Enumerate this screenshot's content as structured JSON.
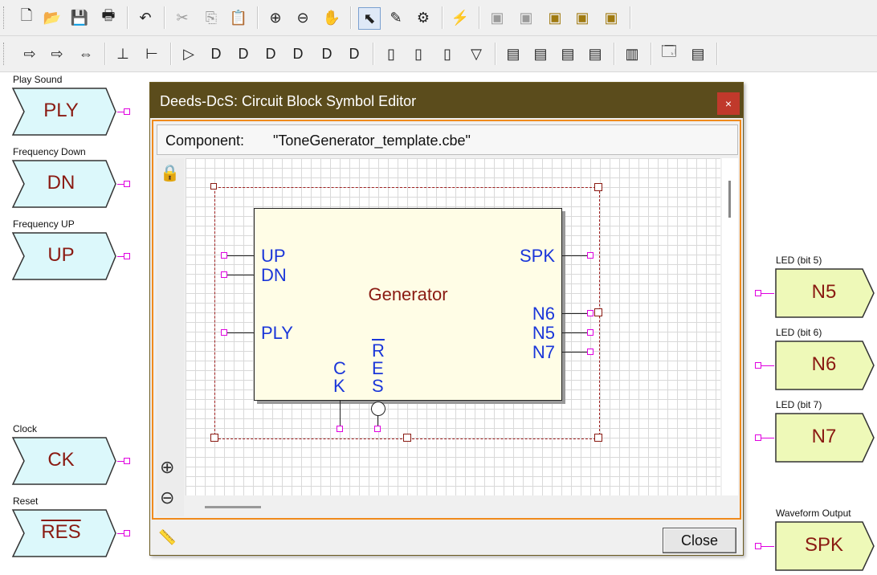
{
  "dialog": {
    "title": "Deeds-DcS: Circuit Block Symbol Editor",
    "close_x": "×",
    "component_label": "Component:",
    "component_value": "\"ToneGenerator_template.cbe\"",
    "close_button": "Close"
  },
  "block": {
    "name": "Generator",
    "left_pins": [
      "UP",
      "DN",
      "PLY"
    ],
    "right_pins": [
      "SPK",
      "N6",
      "N5",
      "N7"
    ],
    "bottom_pins": [
      "C",
      "K",
      "R",
      "E",
      "S"
    ]
  },
  "inputs": [
    {
      "label": "Play Sound",
      "text": "PLY"
    },
    {
      "label": "Frequency Down",
      "text": "DN"
    },
    {
      "label": "Frequency UP",
      "text": "UP"
    },
    {
      "label": "Clock",
      "text": "CK"
    },
    {
      "label": "Reset",
      "text": "RES"
    }
  ],
  "outputs": [
    {
      "label": "LED (bit 5)",
      "text": "N5"
    },
    {
      "label": "LED (bit 6)",
      "text": "N6"
    },
    {
      "label": "LED (bit 7)",
      "text": "N7"
    },
    {
      "label": "Waveform Output",
      "text": "SPK"
    }
  ],
  "colors": {
    "input_fill": "#dcf8fb",
    "output_fill": "#eef9b8",
    "block_fill": "#fffde6",
    "pin": "#e000e0",
    "dialog_title_bg": "#5b4c1c",
    "dialog_border": "#f08a1c",
    "close_red": "#c0392b"
  },
  "toolbar_icons": {
    "row1": [
      "new-icon",
      "open-icon",
      "save-icon",
      "print-icon",
      "undo-icon",
      "cut-icon",
      "copy-icon",
      "paste-icon",
      "zoom-in-icon",
      "zoom-out-icon",
      "hand-icon",
      "pointer-icon",
      "wire-icon",
      "component-icon",
      "simulation-icon",
      "chip-icon",
      "chip-icon",
      "chip-icon",
      "chip-icon",
      "chip-icon"
    ],
    "row2": [
      "input-icon",
      "output-icon",
      "bidir-icon",
      "gnd-icon",
      "probe-icon",
      "buffer-icon",
      "and-icon",
      "or-icon",
      "xor-icon",
      "nand-icon",
      "nor-icon",
      "xnor-icon",
      "flipflop-icon",
      "flipflop-icon",
      "flipflop-icon",
      "flipflop-icon",
      "chip-icon",
      "memory-icon",
      "chip-icon",
      "ram-icon",
      "rom-icon",
      "properties-icon",
      "list-icon"
    ]
  }
}
